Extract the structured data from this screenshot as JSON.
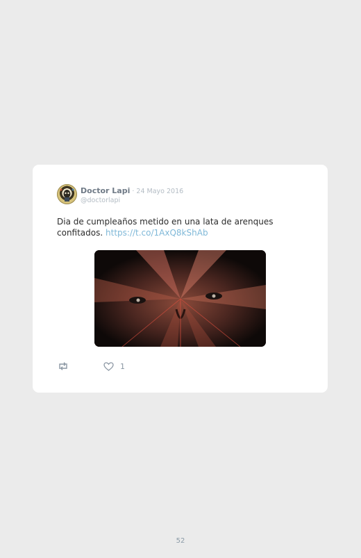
{
  "tweet": {
    "author": {
      "display_name": "Doctor Lapi",
      "handle": "@doctorlapi",
      "avatar_icon": "profile-avatar"
    },
    "date_separator": " · ",
    "date": "24 Mayo 2016",
    "text": "Dia de cumpleaños metido en una lata de arenques confitados. ",
    "link": "https://t.co/1AxQ8kShAb",
    "media": {
      "icon": "video-thumbnail"
    },
    "actions": {
      "retweet_icon": "retweet-icon",
      "like_icon": "heart-icon",
      "like_count": "1"
    }
  },
  "page": {
    "number": "52"
  },
  "colors": {
    "background": "#ebebeb",
    "card": "#ffffff",
    "link": "#7fb8d8",
    "muted": "#b3bcc4"
  }
}
